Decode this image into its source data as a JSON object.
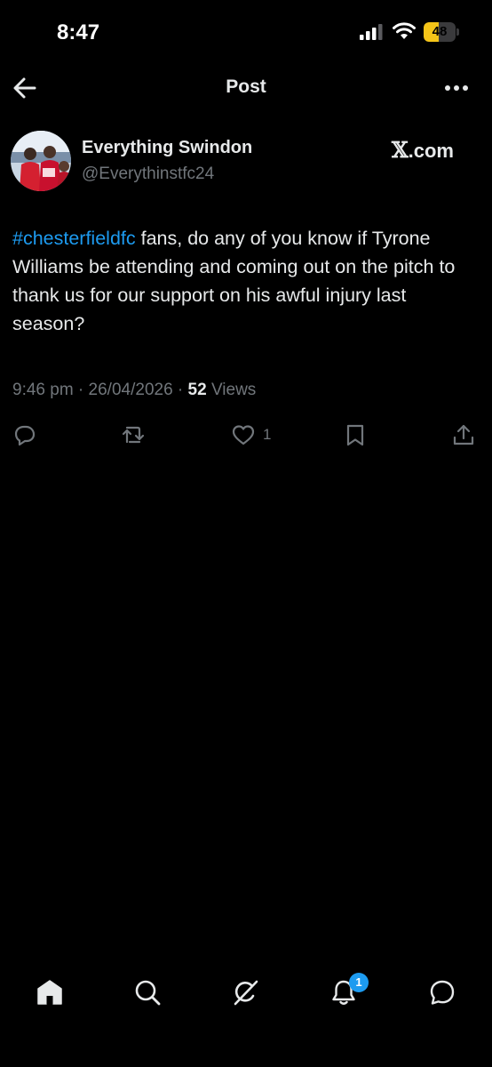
{
  "status_bar": {
    "time": "8:47",
    "battery_level": "48",
    "battery_fraction": 0.48,
    "battery_color": "#f5c518",
    "icons": [
      "cellular-signal-icon",
      "wifi-icon",
      "battery-icon"
    ]
  },
  "header": {
    "title": "Post",
    "back_icon": "arrow-left-icon",
    "more_icon": "more-horizontal-icon"
  },
  "author": {
    "name": "Everything Swindon",
    "handle": "@Everythinstfc24",
    "source_x": "𝕏",
    "source_rest": ".com"
  },
  "post": {
    "hashtag": "#chesterfieldfc",
    "text": " fans, do any of you know if Tyrone Williams be attending and coming out on the pitch to thank us for our support on his awful injury last season?",
    "time": "9:46 pm",
    "separator": " · ",
    "date": "26/04/2026",
    "views_count": "52",
    "views_label": "Views"
  },
  "actions": {
    "reply_icon": "reply-icon",
    "repost_icon": "repost-icon",
    "like_icon": "heart-icon",
    "like_count": "1",
    "bookmark_icon": "bookmark-icon",
    "share_icon": "share-icon"
  },
  "bottom_nav": {
    "items": [
      "home-icon",
      "search-icon",
      "grok-icon",
      "notifications-icon",
      "messages-icon"
    ],
    "notification_badge": "1"
  },
  "colors": {
    "background": "#000000",
    "text_primary": "#e7e9ea",
    "text_secondary": "#71767b",
    "accent": "#1d9bf0"
  }
}
